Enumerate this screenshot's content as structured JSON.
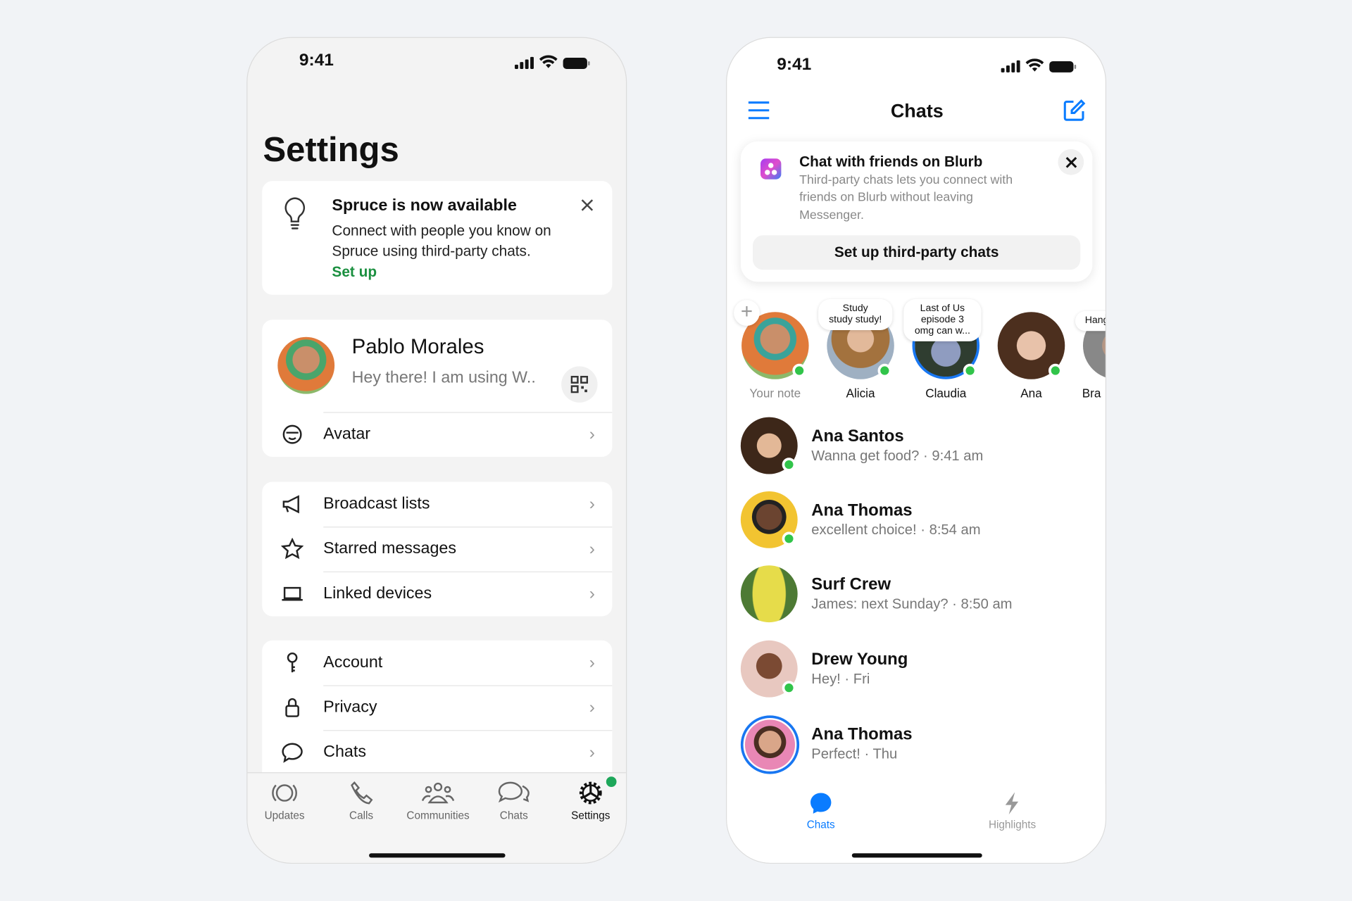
{
  "status_bar": {
    "time": "9:41"
  },
  "settings_screen": {
    "title": "Settings",
    "banner": {
      "title": "Spruce is now available",
      "body_line1": "Connect with people you know on",
      "body_line2": "Spruce using third-party chats.",
      "link": "Set up",
      "icon": "lightbulb-icon"
    },
    "profile": {
      "name": "Pablo Morales",
      "status": "Hey there! I am using W..",
      "qr_icon": "qr-code-icon"
    },
    "avatar_row": {
      "label": "Avatar"
    },
    "group1": [
      {
        "label": "Broadcast lists",
        "icon": "megaphone-icon"
      },
      {
        "label": "Starred messages",
        "icon": "star-icon"
      },
      {
        "label": "Linked devices",
        "icon": "laptop-icon"
      }
    ],
    "group2": [
      {
        "label": "Account",
        "icon": "key-icon"
      },
      {
        "label": "Privacy",
        "icon": "lock-icon"
      },
      {
        "label": "Chats",
        "icon": "chat-bubble-icon"
      }
    ],
    "tabs": [
      {
        "label": "Updates"
      },
      {
        "label": "Calls"
      },
      {
        "label": "Communities"
      },
      {
        "label": "Chats"
      },
      {
        "label": "Settings",
        "active": true
      }
    ],
    "accent": "#1a8f3f"
  },
  "chats_screen": {
    "title": "Chats",
    "banner": {
      "title": "Chat with friends on Blurb",
      "body_line1": "Third-party chats lets you connect with",
      "body_line2": "friends on Blurb without leaving",
      "body_line3": "Messenger.",
      "button": "Set up third-party chats"
    },
    "stories": [
      {
        "name": "Your note",
        "note": ""
      },
      {
        "name": "Alicia",
        "note_line1": "Study",
        "note_line2": "study study!"
      },
      {
        "name": "Claudia",
        "note_line1": "Last of Us",
        "note_line2": "episode 3",
        "note_line3": "omg can w..."
      },
      {
        "name": "Ana"
      },
      {
        "name": "Bra",
        "note_line1": "Hang"
      }
    ],
    "chats": [
      {
        "name": "Ana Santos",
        "preview": "Wanna get food? · 9:41 am",
        "online": true
      },
      {
        "name": "Ana Thomas",
        "preview": "excellent choice! · 8:54 am",
        "online": true
      },
      {
        "name": "Surf Crew",
        "preview": "James: next Sunday? · 8:50 am",
        "online": false
      },
      {
        "name": "Drew Young",
        "preview": "Hey! · Fri",
        "online": true
      },
      {
        "name": "Ana Thomas",
        "preview": "Perfect! · Thu",
        "online": false
      }
    ],
    "tabs": [
      {
        "label": "Chats",
        "active": true
      },
      {
        "label": "Highlights"
      }
    ],
    "accent": "#0a7cff"
  }
}
